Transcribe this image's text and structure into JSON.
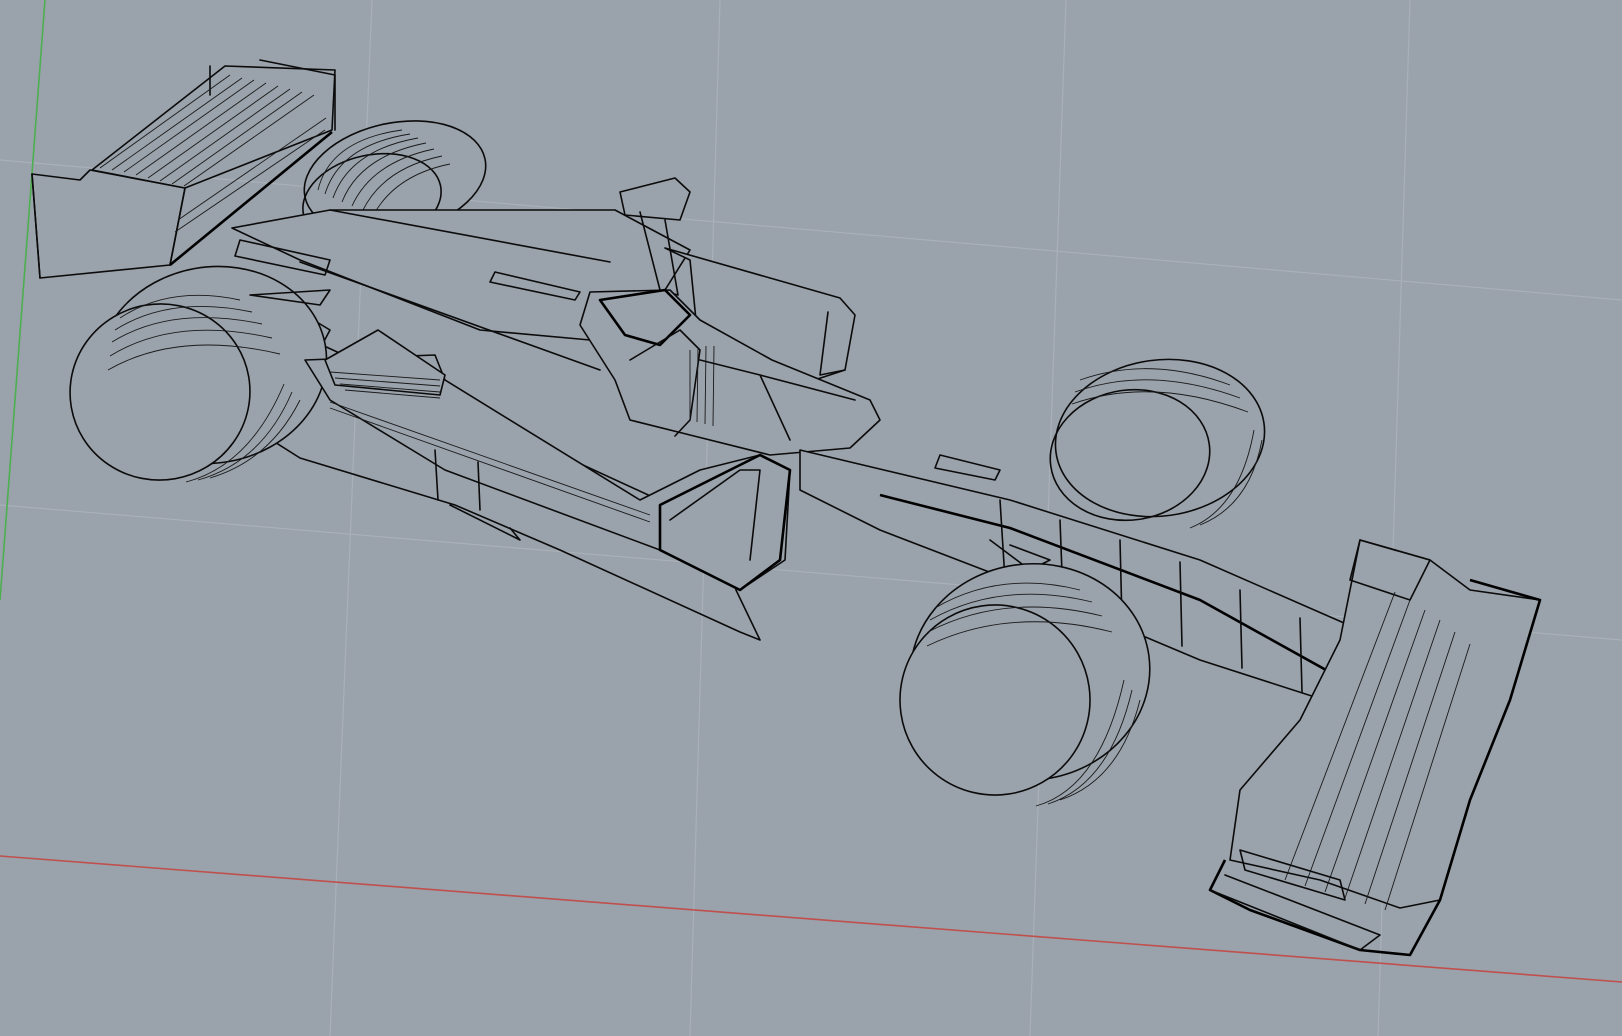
{
  "viewport": {
    "projection": "perspective",
    "display_mode": "wireframe",
    "model": "formula-one-car",
    "background_color": "#9aa2ab",
    "grid_color": "#a9b0b8",
    "wire_color": "#0b0b0b",
    "x_axis_color": "#c0504d",
    "y_axis_color": "#4caf50"
  }
}
